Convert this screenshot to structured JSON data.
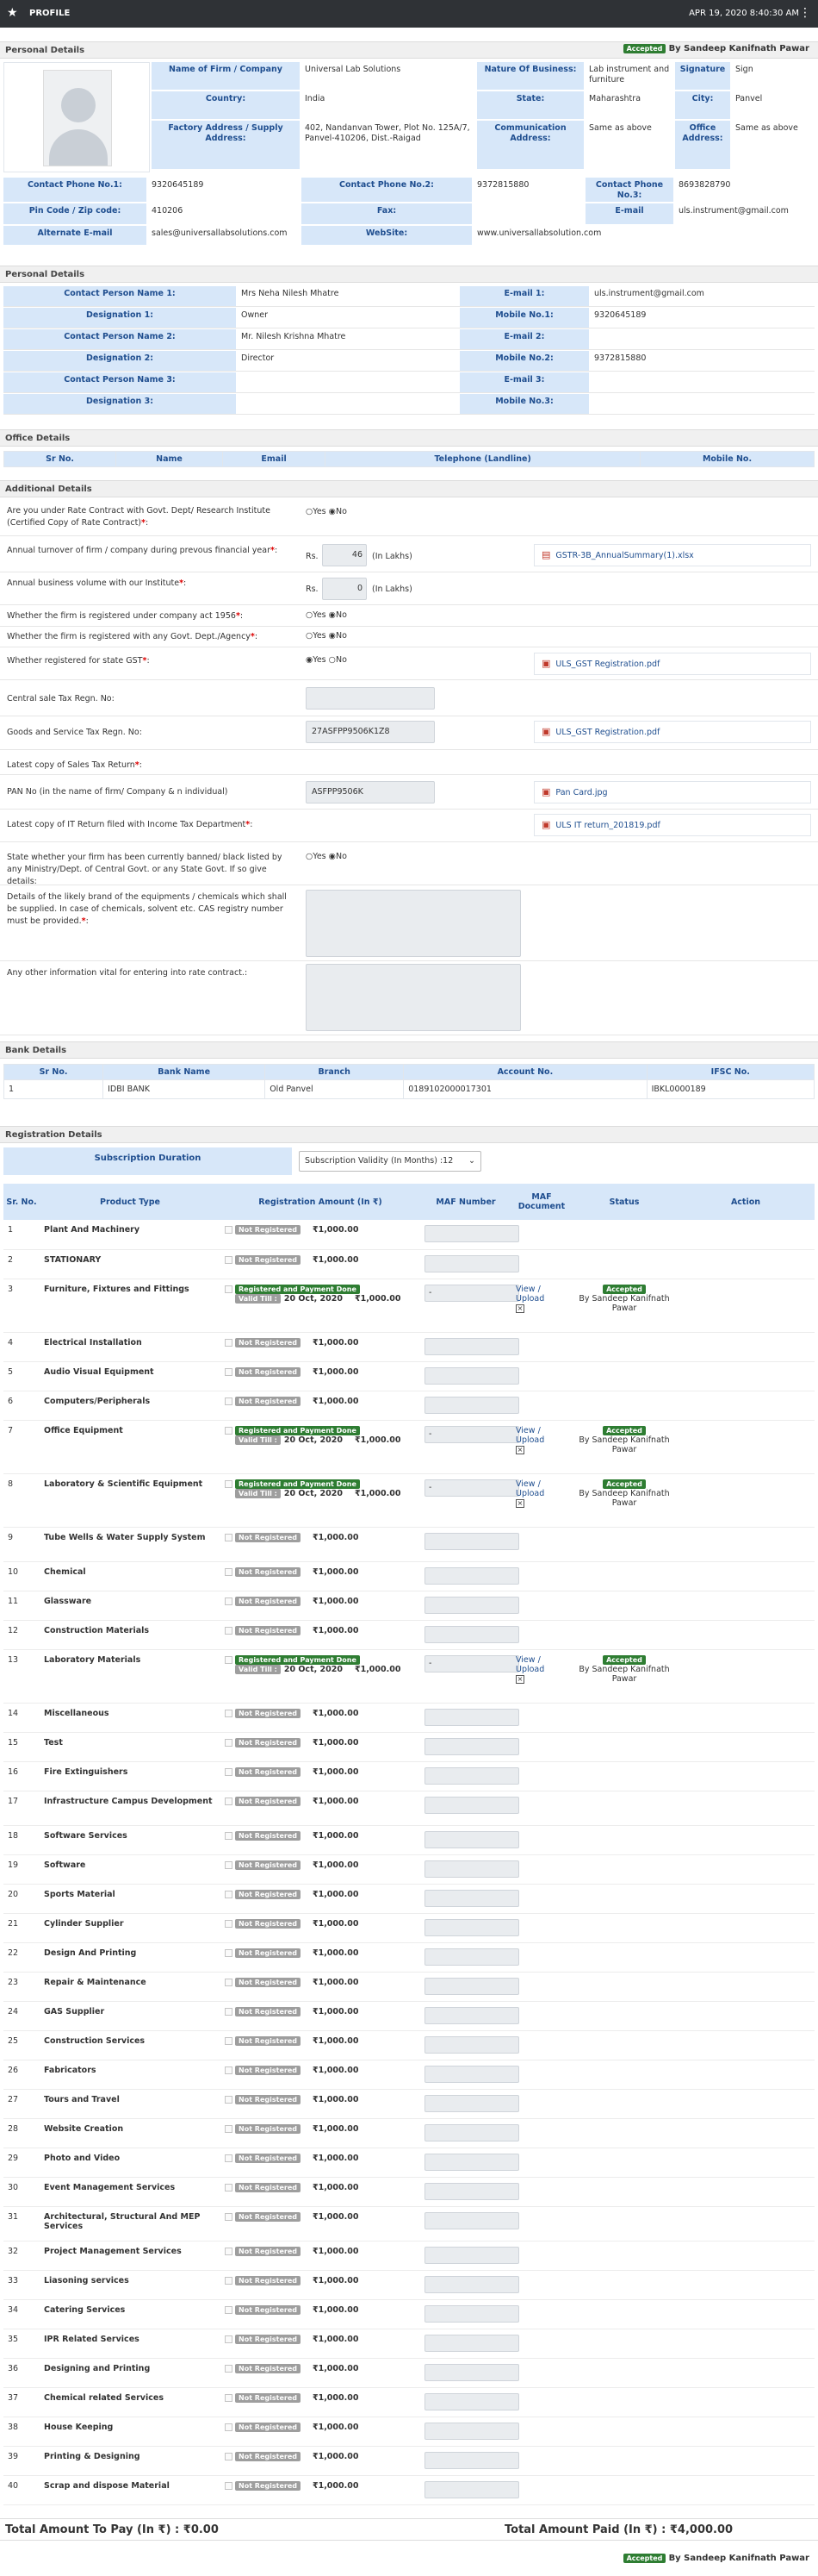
{
  "topbar": {
    "title": "PROFILE",
    "datetime": "APR 19, 2020   8:40:30 AM"
  },
  "sections": {
    "personal": "Personal Details",
    "contact": "Personal Details",
    "office": "Office Details",
    "additional": "Additional Details",
    "bank": "Bank Details",
    "registration": "Registration Details"
  },
  "status": {
    "badge": "Accepted",
    "by": "By Sandeep Kanifnath Pawar"
  },
  "firm": {
    "name_label": "Name of Firm / Company",
    "name": "Universal Lab Solutions",
    "nature_label": "Nature Of Business:",
    "nature": "Lab instrument and furniture",
    "signature_label": "Signature",
    "signature": "Sign",
    "country_label": "Country:",
    "country": "India",
    "state_label": "State:",
    "state": "Maharashtra",
    "city_label": "City:",
    "city": "Panvel",
    "factory_label": "Factory Address / Supply Address:",
    "factory": "402, Nandanvan Tower, Plot No. 125A/7, Panvel-410206, Dist.-Raigad",
    "comm_label": "Communication Address:",
    "comm": "Same as above",
    "office_label": "Office Address:",
    "office": "Same as above",
    "phone1_label": "Contact Phone No.1:",
    "phone1": "9320645189",
    "phone2_label": "Contact Phone No.2:",
    "phone2": "9372815880",
    "phone3_label": "Contact Phone No.3:",
    "phone3": "8693828790",
    "pin_label": "Pin Code / Zip code:",
    "pin": "410206",
    "fax_label": "Fax:",
    "fax": "",
    "email_label": "E-mail",
    "email": "uls.instrument@gmail.com",
    "altemail_label": "Alternate E-mail",
    "altemail": "sales@universallabsolutions.com",
    "website_label": "WebSite:",
    "website": "www.universallabsolution.com"
  },
  "contacts": [
    {
      "l1": "Contact Person Name 1:",
      "v1": "Mrs Neha Nilesh Mhatre",
      "l2": "E-mail 1:",
      "v2": "uls.instrument@gmail.com"
    },
    {
      "l1": "Designation 1:",
      "v1": "Owner",
      "l2": "Mobile No.1:",
      "v2": "9320645189"
    },
    {
      "l1": "Contact Person Name 2:",
      "v1": "Mr. Nilesh Krishna Mhatre",
      "l2": "E-mail 2:",
      "v2": ""
    },
    {
      "l1": "Designation 2:",
      "v1": "Director",
      "l2": "Mobile No.2:",
      "v2": "9372815880"
    },
    {
      "l1": "Contact Person Name 3:",
      "v1": "",
      "l2": "E-mail 3:",
      "v2": ""
    },
    {
      "l1": "Designation 3:",
      "v1": "",
      "l2": "Mobile No.3:",
      "v2": ""
    }
  ],
  "office_cols": [
    "Sr No.",
    "Name",
    "Email",
    "Telephone (Landline)",
    "Mobile No."
  ],
  "additional": {
    "q1": "Are you under Rate Contract with Govt. Dept/ Research Institute (Certified Copy of Rate Contract)",
    "q1a": "Yes",
    "q1b": "No",
    "q2": "Annual turnover of firm / company during prevous financial year",
    "q2rs": "Rs.",
    "q2val": "46",
    "q2unit": "(In Lakhs)",
    "q2file": "GSTR-3B_AnnualSummary(1).xlsx",
    "q3": "Annual business volume with our Institute",
    "q3rs": "Rs.",
    "q3val": "0",
    "q3unit": "(In Lakhs)",
    "q4": "Whether the firm is registered under company act 1956",
    "q4a": "Yes",
    "q4b": "No",
    "q5": "Whether the firm is registered with any Govt. Dept./Agency",
    "q5a": "Yes",
    "q5b": "No",
    "q6": "Whether registered for state GST",
    "q6a": "Yes",
    "q6b": "No",
    "q6file": "ULS_GST Registration.pdf",
    "q7": "Central sale Tax Regn. No:",
    "q7val": "",
    "q8": "Goods and Service Tax Regn. No:",
    "q8val": "27ASFPP9506K1Z8",
    "q8file": "ULS_GST Registration.pdf",
    "q9": "Latest copy of Sales Tax Return",
    "q10": "PAN No (in the name of firm/ Company & n individual)",
    "q10val": "ASFPP9506K",
    "q10file": "Pan Card.jpg",
    "q11": "Latest copy of IT Return filed with Income Tax Department",
    "q11file": "ULS IT return_201819.pdf",
    "q12": "State whether your firm has been currently banned/ black listed by any Ministry/Dept. of Central Govt. or any State Govt. If so give details",
    "q12a": "Yes",
    "q12b": "No",
    "q13": "Details of the likely brand of the equipments / chemicals which shall be supplied. In case of chemicals, solvent etc. CAS registry number must be provided.",
    "q14": "Any other information vital for entering into rate contract.:"
  },
  "bank": {
    "cols": [
      "Sr No.",
      "Bank Name",
      "Branch",
      "Account No.",
      "IFSC No."
    ],
    "row": [
      "1",
      "IDBI BANK",
      "Old Panvel",
      "0189102000017301",
      "IBKL0000189"
    ]
  },
  "subscription": {
    "label": "Subscription Duration",
    "value": "Subscription Validity (In Months) :12"
  },
  "reg": {
    "cols": [
      "Sr. No.",
      "Product Type",
      "Registration Amount (In ₹)",
      "MAF Number",
      "MAF Document",
      "Status",
      "Action"
    ],
    "nr": "Not Registered",
    "rp": "Registered and Payment Done",
    "valid": "Valid Till :",
    "view": "View / Upload",
    "amount": "₹1,000.00",
    "rows": [
      {
        "n": "1",
        "t": "Plant And Machinery"
      },
      {
        "n": "2",
        "t": "STATIONARY"
      },
      {
        "n": "3",
        "t": "Furniture, Fixtures and Fittings",
        "reg": true,
        "date": "20 Oct, 2020",
        "maf": "-"
      },
      {
        "n": "4",
        "t": "Electrical Installation"
      },
      {
        "n": "5",
        "t": "Audio Visual Equipment"
      },
      {
        "n": "6",
        "t": "Computers/Peripherals"
      },
      {
        "n": "7",
        "t": "Office Equipment",
        "reg": true,
        "date": "20 Oct, 2020",
        "maf": "-"
      },
      {
        "n": "8",
        "t": "Laboratory & Scientific Equipment",
        "reg": true,
        "date": "20 Oct, 2020",
        "maf": "-"
      },
      {
        "n": "9",
        "t": "Tube Wells & Water Supply System"
      },
      {
        "n": "10",
        "t": "Chemical"
      },
      {
        "n": "11",
        "t": "Glassware"
      },
      {
        "n": "12",
        "t": "Construction Materials"
      },
      {
        "n": "13",
        "t": "Laboratory Materials",
        "reg": true,
        "date": "20 Oct, 2020",
        "maf": "-"
      },
      {
        "n": "14",
        "t": "Miscellaneous"
      },
      {
        "n": "15",
        "t": "Test"
      },
      {
        "n": "16",
        "t": "Fire Extinguishers"
      },
      {
        "n": "17",
        "t": "Infrastructure Campus Development"
      },
      {
        "n": "18",
        "t": "Software Services"
      },
      {
        "n": "19",
        "t": "Software"
      },
      {
        "n": "20",
        "t": "Sports Material"
      },
      {
        "n": "21",
        "t": "Cylinder Supplier"
      },
      {
        "n": "22",
        "t": "Design And Printing"
      },
      {
        "n": "23",
        "t": "Repair & Maintenance"
      },
      {
        "n": "24",
        "t": "GAS Supplier"
      },
      {
        "n": "25",
        "t": "Construction Services"
      },
      {
        "n": "26",
        "t": "Fabricators"
      },
      {
        "n": "27",
        "t": "Tours and Travel"
      },
      {
        "n": "28",
        "t": "Website Creation"
      },
      {
        "n": "29",
        "t": "Photo and Video"
      },
      {
        "n": "30",
        "t": "Event Management Services"
      },
      {
        "n": "31",
        "t": "Architectural, Structural And MEP Services"
      },
      {
        "n": "32",
        "t": "Project Management Services"
      },
      {
        "n": "33",
        "t": "Liasoning services"
      },
      {
        "n": "34",
        "t": "Catering Services"
      },
      {
        "n": "35",
        "t": "IPR Related Services"
      },
      {
        "n": "36",
        "t": "Designing and Printing"
      },
      {
        "n": "37",
        "t": "Chemical related Services"
      },
      {
        "n": "38",
        "t": "House Keeping"
      },
      {
        "n": "39",
        "t": "Printing & Designing"
      },
      {
        "n": "40",
        "t": "Scrap and dispose Material"
      }
    ]
  },
  "totals": {
    "topay_label": "Total Amount To Pay (In ₹) :",
    "topay": "₹0.00",
    "paid_label": "Total Amount Paid (In ₹) :",
    "paid": "₹4,000.00"
  },
  "colors": {
    "header": "#2f3236",
    "label_bg": "#d7e7f9",
    "label_text": "#1f4e8f",
    "accepted": "#2e7d32",
    "not_registered": "#9e9e9e"
  }
}
